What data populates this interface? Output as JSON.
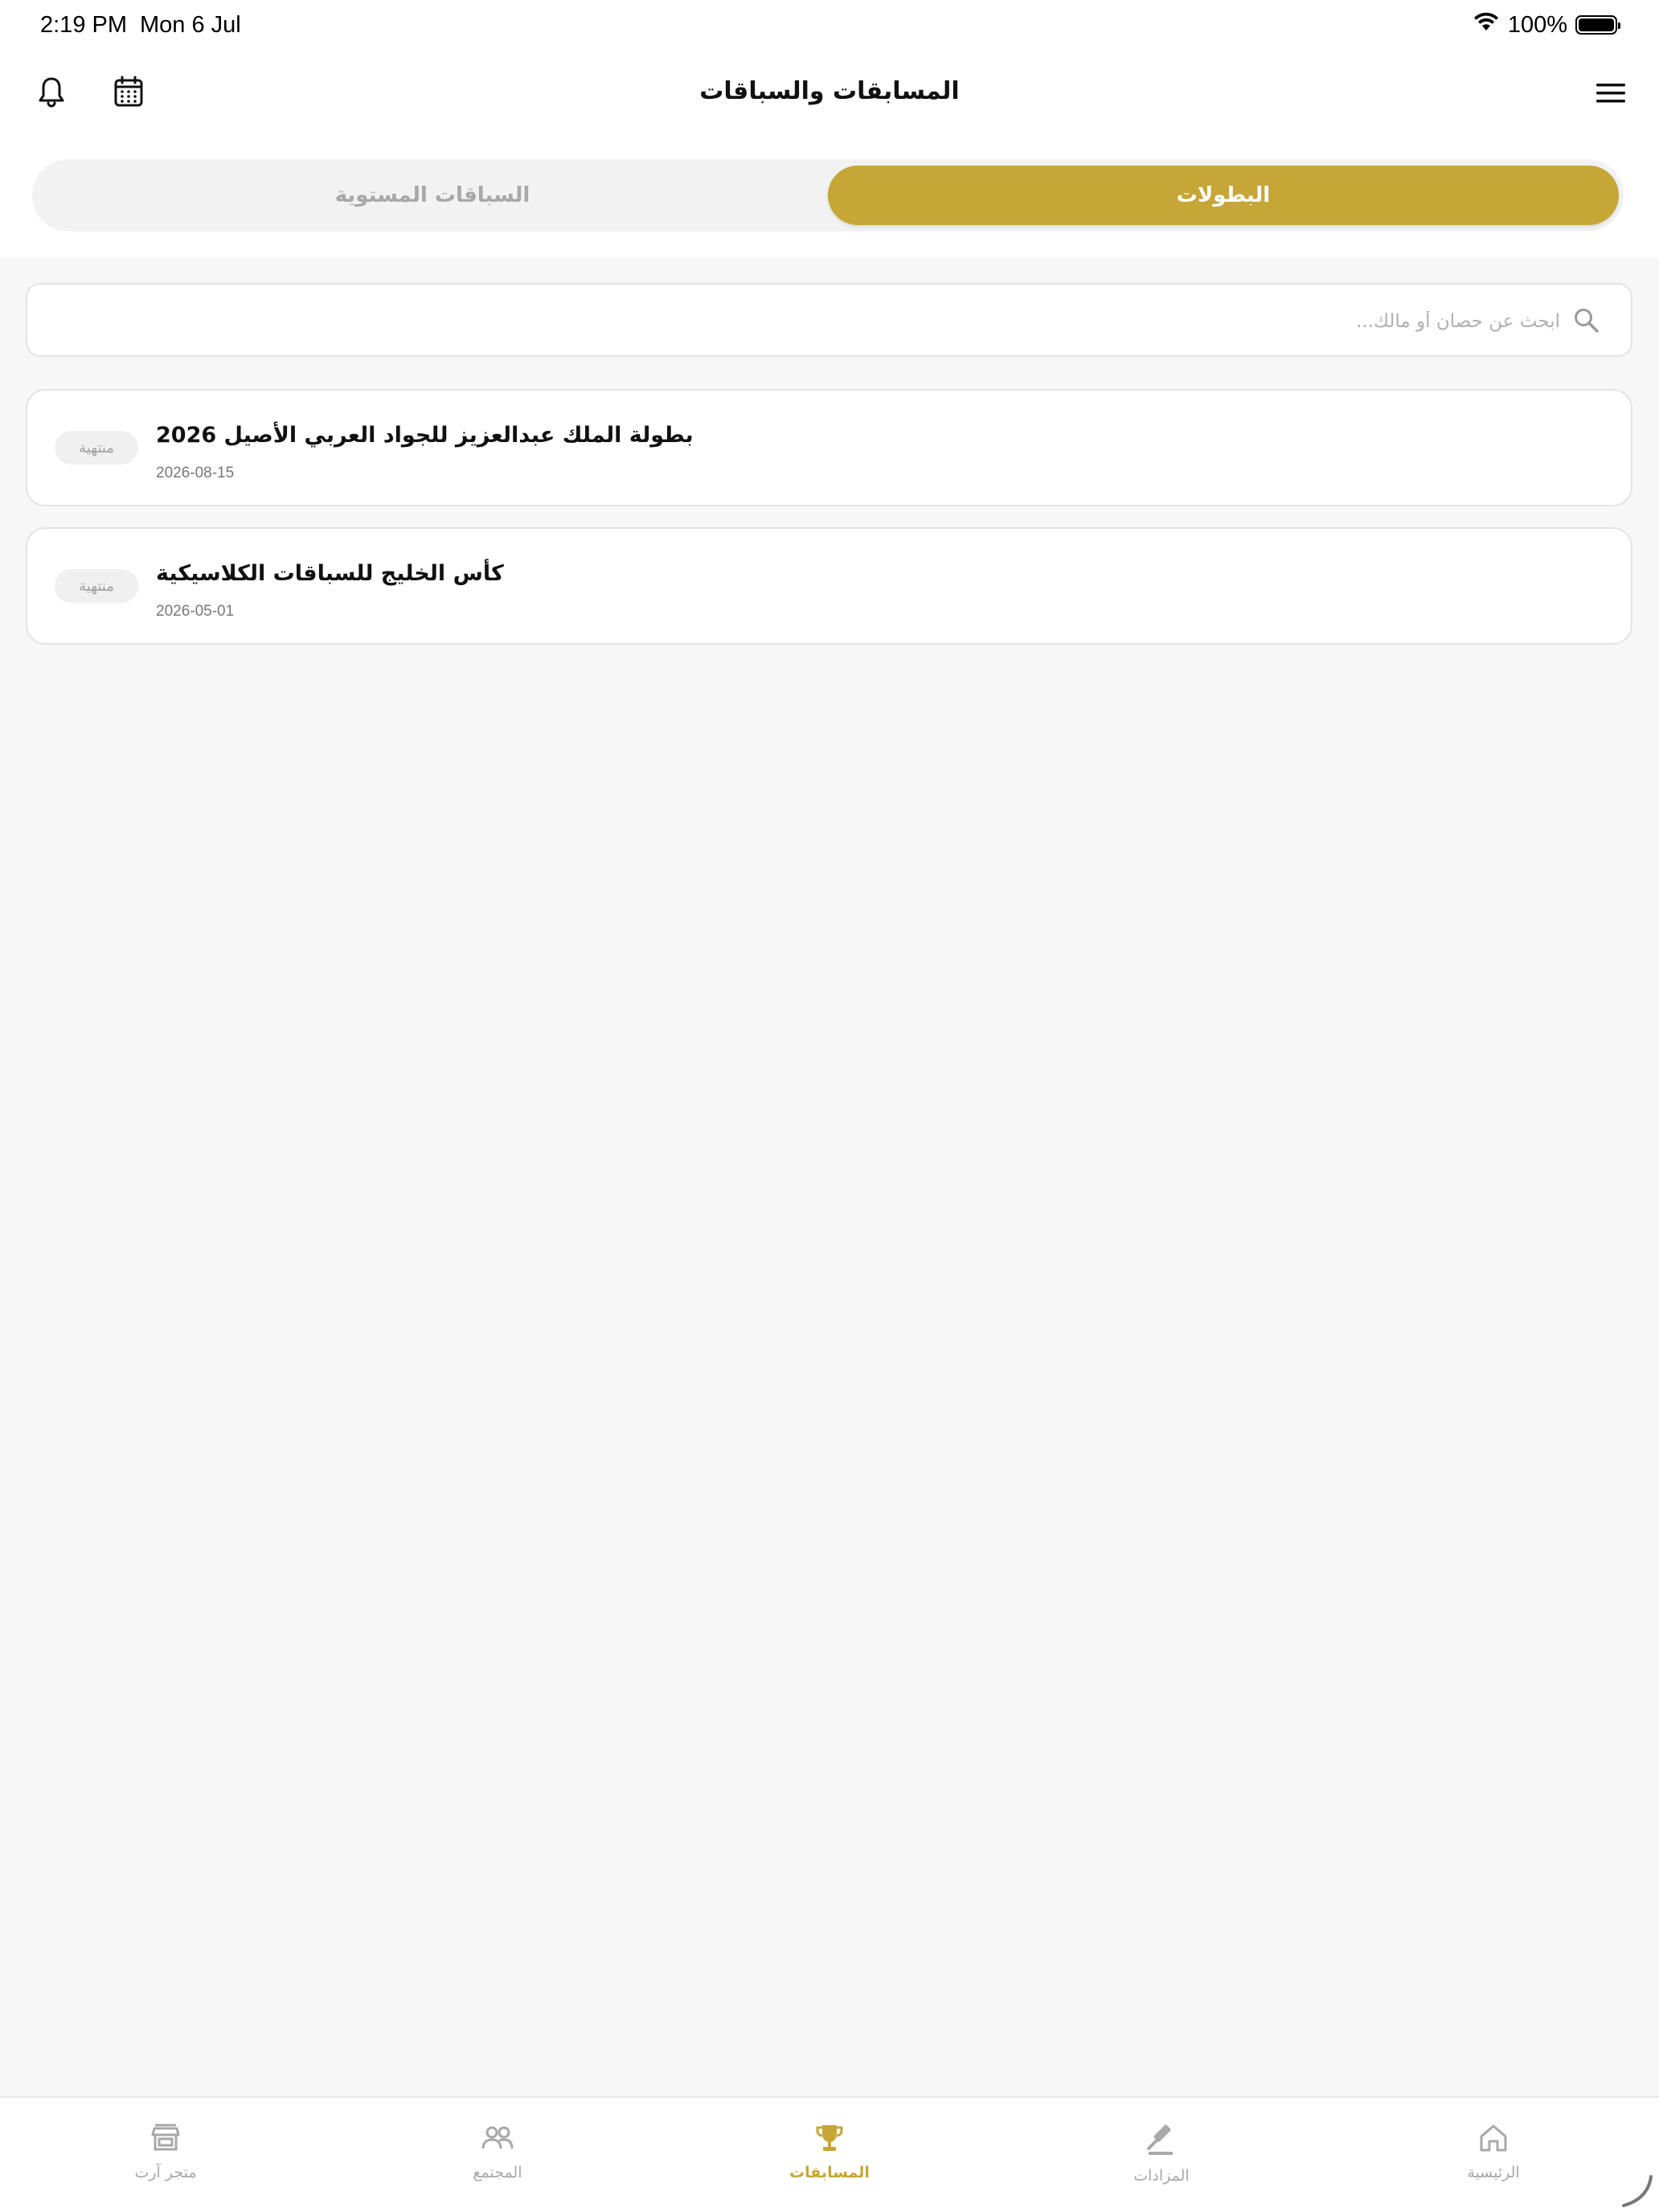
{
  "status_bar": {
    "time": "2:19 PM",
    "date": "Mon 6 Jul",
    "battery": "100%"
  },
  "header": {
    "title": "المسابقات والسباقات",
    "icons": [
      "menu-icon",
      "calendar-icon",
      "bell-icon"
    ]
  },
  "tabs": [
    {
      "label": "البطولات",
      "active": true
    },
    {
      "label": "السباقات المستوية",
      "active": false
    }
  ],
  "search": {
    "placeholder": "ابحث عن حصان أو مالك...",
    "value": ""
  },
  "championships": [
    {
      "title": "بطولة الملك عبدالعزيز للجواد العربي الأصيل 2026",
      "date": "2026-08-15",
      "status": "منتهية"
    },
    {
      "title": "كأس الخليج للسباقات الكلاسيكية",
      "date": "2026-05-01",
      "status": "منتهية"
    }
  ],
  "bottom_nav": [
    {
      "label": "متجر آرت",
      "icon": "store-icon",
      "active": false
    },
    {
      "label": "المجتمع",
      "icon": "community-icon",
      "active": false
    },
    {
      "label": "المسابقات",
      "icon": "trophy-icon",
      "active": true
    },
    {
      "label": "المزادات",
      "icon": "gavel-icon",
      "active": false
    },
    {
      "label": "الرئيسية",
      "icon": "home-icon",
      "active": false
    }
  ],
  "colors": {
    "accent": "#c6a637",
    "background": "#f7f7f7",
    "card_border": "#e4e4e4",
    "inactive_text": "#a8a8a8"
  }
}
